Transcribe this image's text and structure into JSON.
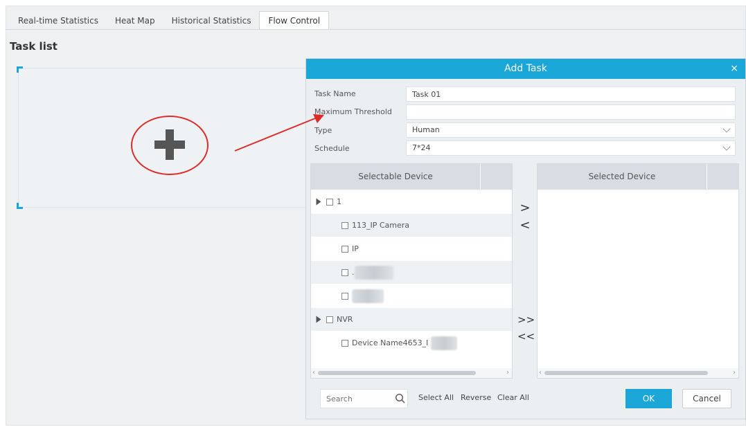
{
  "tabs": [
    {
      "label": "Real-time Statistics"
    },
    {
      "label": "Heat Map"
    },
    {
      "label": "Historical Statistics"
    },
    {
      "label": "Flow Control"
    }
  ],
  "active_tab": "Flow Control",
  "task_list": {
    "title": "Task list"
  },
  "dialog": {
    "title": "Add Task",
    "close_glyph": "×",
    "fields": {
      "task_name": {
        "label": "Task Name",
        "value": "Task 01"
      },
      "max_threshold": {
        "label": "Maximum Threshold",
        "value": ""
      },
      "type": {
        "label": "Type",
        "value": "Human"
      },
      "schedule": {
        "label": "Schedule",
        "value": "7*24"
      }
    },
    "selectable": {
      "header": "Selectable Device",
      "tree": [
        {
          "label": "1"
        },
        {
          "label": "113_IP Camera"
        },
        {
          "label": "IP"
        },
        {
          "label": "."
        },
        {
          "label": ""
        },
        {
          "label": "NVR"
        },
        {
          "label": "Device Name4653_I"
        }
      ]
    },
    "selected": {
      "header": "Selected Device"
    },
    "move_buttons": {
      "add": ">",
      "remove": "<",
      "add_all": ">>",
      "remove_all": "<<"
    },
    "search": {
      "placeholder": "Search"
    },
    "actions": {
      "select_all": "Select All",
      "reverse": "Reverse",
      "clear_all": "Clear All",
      "ok": "OK",
      "cancel": "Cancel"
    }
  },
  "colors": {
    "accent": "#1aa6d6",
    "annotation": "#e02a2a"
  }
}
